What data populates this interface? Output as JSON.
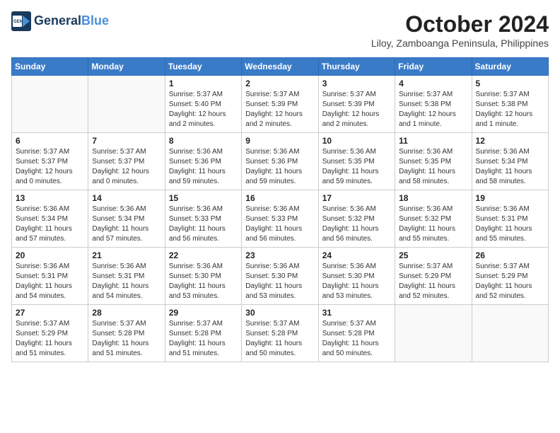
{
  "header": {
    "logo_line1": "General",
    "logo_line2": "Blue",
    "month_title": "October 2024",
    "location": "Liloy, Zamboanga Peninsula, Philippines"
  },
  "weekdays": [
    "Sunday",
    "Monday",
    "Tuesday",
    "Wednesday",
    "Thursday",
    "Friday",
    "Saturday"
  ],
  "weeks": [
    [
      {
        "day": "",
        "info": ""
      },
      {
        "day": "",
        "info": ""
      },
      {
        "day": "1",
        "info": "Sunrise: 5:37 AM\nSunset: 5:40 PM\nDaylight: 12 hours\nand 2 minutes."
      },
      {
        "day": "2",
        "info": "Sunrise: 5:37 AM\nSunset: 5:39 PM\nDaylight: 12 hours\nand 2 minutes."
      },
      {
        "day": "3",
        "info": "Sunrise: 5:37 AM\nSunset: 5:39 PM\nDaylight: 12 hours\nand 2 minutes."
      },
      {
        "day": "4",
        "info": "Sunrise: 5:37 AM\nSunset: 5:38 PM\nDaylight: 12 hours\nand 1 minute."
      },
      {
        "day": "5",
        "info": "Sunrise: 5:37 AM\nSunset: 5:38 PM\nDaylight: 12 hours\nand 1 minute."
      }
    ],
    [
      {
        "day": "6",
        "info": "Sunrise: 5:37 AM\nSunset: 5:37 PM\nDaylight: 12 hours\nand 0 minutes."
      },
      {
        "day": "7",
        "info": "Sunrise: 5:37 AM\nSunset: 5:37 PM\nDaylight: 12 hours\nand 0 minutes."
      },
      {
        "day": "8",
        "info": "Sunrise: 5:36 AM\nSunset: 5:36 PM\nDaylight: 11 hours\nand 59 minutes."
      },
      {
        "day": "9",
        "info": "Sunrise: 5:36 AM\nSunset: 5:36 PM\nDaylight: 11 hours\nand 59 minutes."
      },
      {
        "day": "10",
        "info": "Sunrise: 5:36 AM\nSunset: 5:35 PM\nDaylight: 11 hours\nand 59 minutes."
      },
      {
        "day": "11",
        "info": "Sunrise: 5:36 AM\nSunset: 5:35 PM\nDaylight: 11 hours\nand 58 minutes."
      },
      {
        "day": "12",
        "info": "Sunrise: 5:36 AM\nSunset: 5:34 PM\nDaylight: 11 hours\nand 58 minutes."
      }
    ],
    [
      {
        "day": "13",
        "info": "Sunrise: 5:36 AM\nSunset: 5:34 PM\nDaylight: 11 hours\nand 57 minutes."
      },
      {
        "day": "14",
        "info": "Sunrise: 5:36 AM\nSunset: 5:34 PM\nDaylight: 11 hours\nand 57 minutes."
      },
      {
        "day": "15",
        "info": "Sunrise: 5:36 AM\nSunset: 5:33 PM\nDaylight: 11 hours\nand 56 minutes."
      },
      {
        "day": "16",
        "info": "Sunrise: 5:36 AM\nSunset: 5:33 PM\nDaylight: 11 hours\nand 56 minutes."
      },
      {
        "day": "17",
        "info": "Sunrise: 5:36 AM\nSunset: 5:32 PM\nDaylight: 11 hours\nand 56 minutes."
      },
      {
        "day": "18",
        "info": "Sunrise: 5:36 AM\nSunset: 5:32 PM\nDaylight: 11 hours\nand 55 minutes."
      },
      {
        "day": "19",
        "info": "Sunrise: 5:36 AM\nSunset: 5:31 PM\nDaylight: 11 hours\nand 55 minutes."
      }
    ],
    [
      {
        "day": "20",
        "info": "Sunrise: 5:36 AM\nSunset: 5:31 PM\nDaylight: 11 hours\nand 54 minutes."
      },
      {
        "day": "21",
        "info": "Sunrise: 5:36 AM\nSunset: 5:31 PM\nDaylight: 11 hours\nand 54 minutes."
      },
      {
        "day": "22",
        "info": "Sunrise: 5:36 AM\nSunset: 5:30 PM\nDaylight: 11 hours\nand 53 minutes."
      },
      {
        "day": "23",
        "info": "Sunrise: 5:36 AM\nSunset: 5:30 PM\nDaylight: 11 hours\nand 53 minutes."
      },
      {
        "day": "24",
        "info": "Sunrise: 5:36 AM\nSunset: 5:30 PM\nDaylight: 11 hours\nand 53 minutes."
      },
      {
        "day": "25",
        "info": "Sunrise: 5:37 AM\nSunset: 5:29 PM\nDaylight: 11 hours\nand 52 minutes."
      },
      {
        "day": "26",
        "info": "Sunrise: 5:37 AM\nSunset: 5:29 PM\nDaylight: 11 hours\nand 52 minutes."
      }
    ],
    [
      {
        "day": "27",
        "info": "Sunrise: 5:37 AM\nSunset: 5:29 PM\nDaylight: 11 hours\nand 51 minutes."
      },
      {
        "day": "28",
        "info": "Sunrise: 5:37 AM\nSunset: 5:28 PM\nDaylight: 11 hours\nand 51 minutes."
      },
      {
        "day": "29",
        "info": "Sunrise: 5:37 AM\nSunset: 5:28 PM\nDaylight: 11 hours\nand 51 minutes."
      },
      {
        "day": "30",
        "info": "Sunrise: 5:37 AM\nSunset: 5:28 PM\nDaylight: 11 hours\nand 50 minutes."
      },
      {
        "day": "31",
        "info": "Sunrise: 5:37 AM\nSunset: 5:28 PM\nDaylight: 11 hours\nand 50 minutes."
      },
      {
        "day": "",
        "info": ""
      },
      {
        "day": "",
        "info": ""
      }
    ]
  ]
}
